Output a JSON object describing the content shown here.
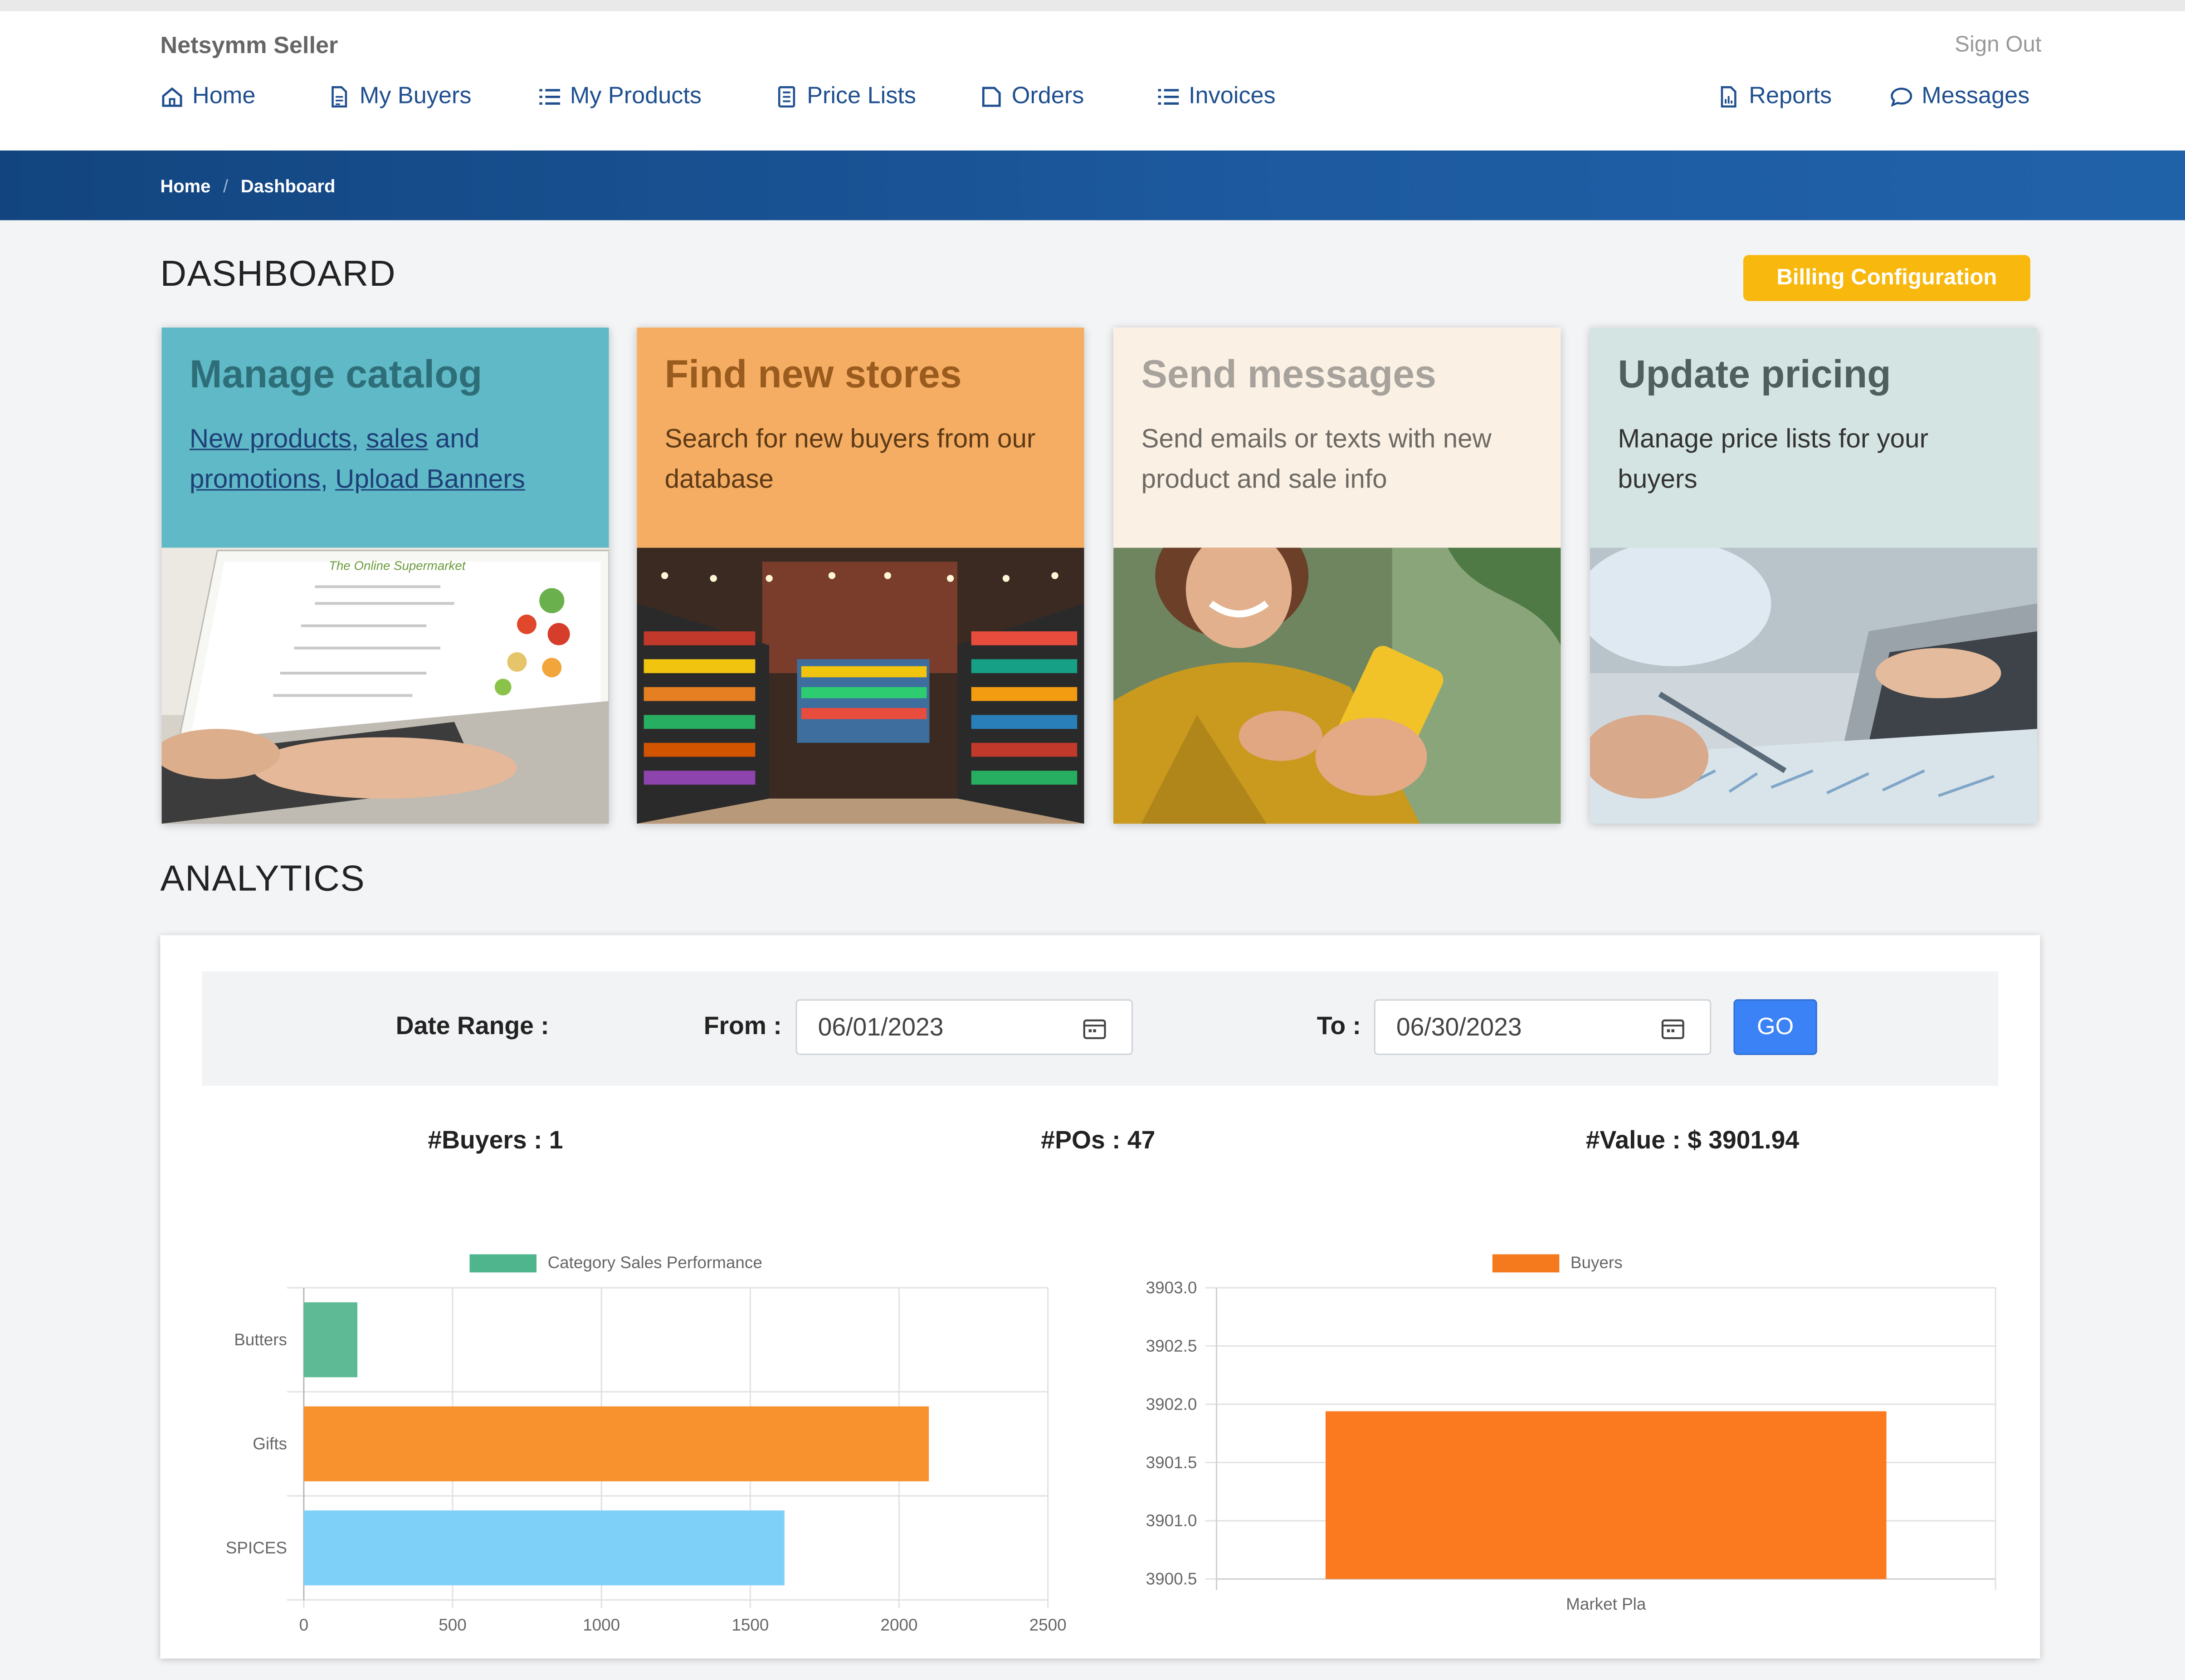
{
  "app": {
    "brand": "Netsymm Seller",
    "sign_out": "Sign Out"
  },
  "nav": [
    {
      "label": "Home",
      "icon": "home-icon"
    },
    {
      "label": "My Buyers",
      "icon": "document-icon"
    },
    {
      "label": "My Products",
      "icon": "list-icon"
    },
    {
      "label": "Price Lists",
      "icon": "price-list-icon"
    },
    {
      "label": "Orders",
      "icon": "orders-icon"
    },
    {
      "label": "Invoices",
      "icon": "list-icon"
    },
    {
      "label": "Reports",
      "icon": "report-icon"
    },
    {
      "label": "Messages",
      "icon": "chat-icon"
    }
  ],
  "breadcrumb": [
    "Home",
    "Dashboard"
  ],
  "dashboard": {
    "title": "DASHBOARD",
    "billing_button": "Billing Configuration",
    "cards": [
      {
        "title": "Manage catalog",
        "links": [
          "New products",
          "sales",
          "promotions",
          "Upload Banners"
        ],
        "joiners": [
          ", ",
          " and ",
          ", "
        ],
        "image": "laptop-grocery-catalog-photo",
        "bg": "#5fb9c6",
        "title_color": "#2e6e78"
      },
      {
        "title": "Find new stores",
        "text": "Search for new buyers from our database",
        "image": "supermarket-aisle-photo",
        "bg": "#f4ad62",
        "title_color": "#9a5b1e"
      },
      {
        "title": "Send messages",
        "text": "Send emails or texts with new product and sale info",
        "image": "woman-with-phone-photo",
        "bg": "#faf0e3",
        "title_color": "#a7a39c"
      },
      {
        "title": "Update pricing",
        "text": "Manage price lists for your buyers",
        "image": "hand-with-pen-laptop-photo",
        "bg": "#d4e4e2",
        "title_color": "#4f5f5e"
      }
    ]
  },
  "analytics": {
    "title": "ANALYTICS",
    "date_range_label": "Date Range :",
    "from_label": "From :",
    "from_value": "06/01/2023",
    "to_label": "To :",
    "to_value": "06/30/2023",
    "go_label": "GO",
    "stats": {
      "buyers": "#Buyers : 1",
      "pos": "#POs : 47",
      "value": "#Value : $ 3901.94"
    }
  },
  "chart_data": [
    {
      "type": "bar",
      "orientation": "horizontal",
      "title": "",
      "legend": {
        "label": "Category Sales Performance",
        "color": "#4eb58c",
        "position": "top"
      },
      "categories": [
        "Butters",
        "Gifts",
        "SPICES"
      ],
      "values": [
        180,
        2100,
        1615
      ],
      "colors": [
        "#5dba95",
        "#f7922e",
        "#7fd0f8"
      ],
      "xlim": [
        0,
        2500
      ],
      "xticks": [
        "0",
        "500",
        "1000",
        "1500",
        "2000",
        "2500"
      ],
      "grid": true
    },
    {
      "type": "bar",
      "orientation": "vertical",
      "title": "",
      "legend": {
        "label": "Buyers",
        "color": "#f57a1e",
        "position": "top"
      },
      "categories": [
        "Market Pla"
      ],
      "values": [
        3901.94
      ],
      "colors": [
        "#fb7a1f"
      ],
      "ylim": [
        3900.5,
        3903.0
      ],
      "yticks": [
        "3903.0",
        "3902.5",
        "3902.0",
        "3901.5",
        "3901.0",
        "3900.5"
      ],
      "grid": true
    }
  ]
}
